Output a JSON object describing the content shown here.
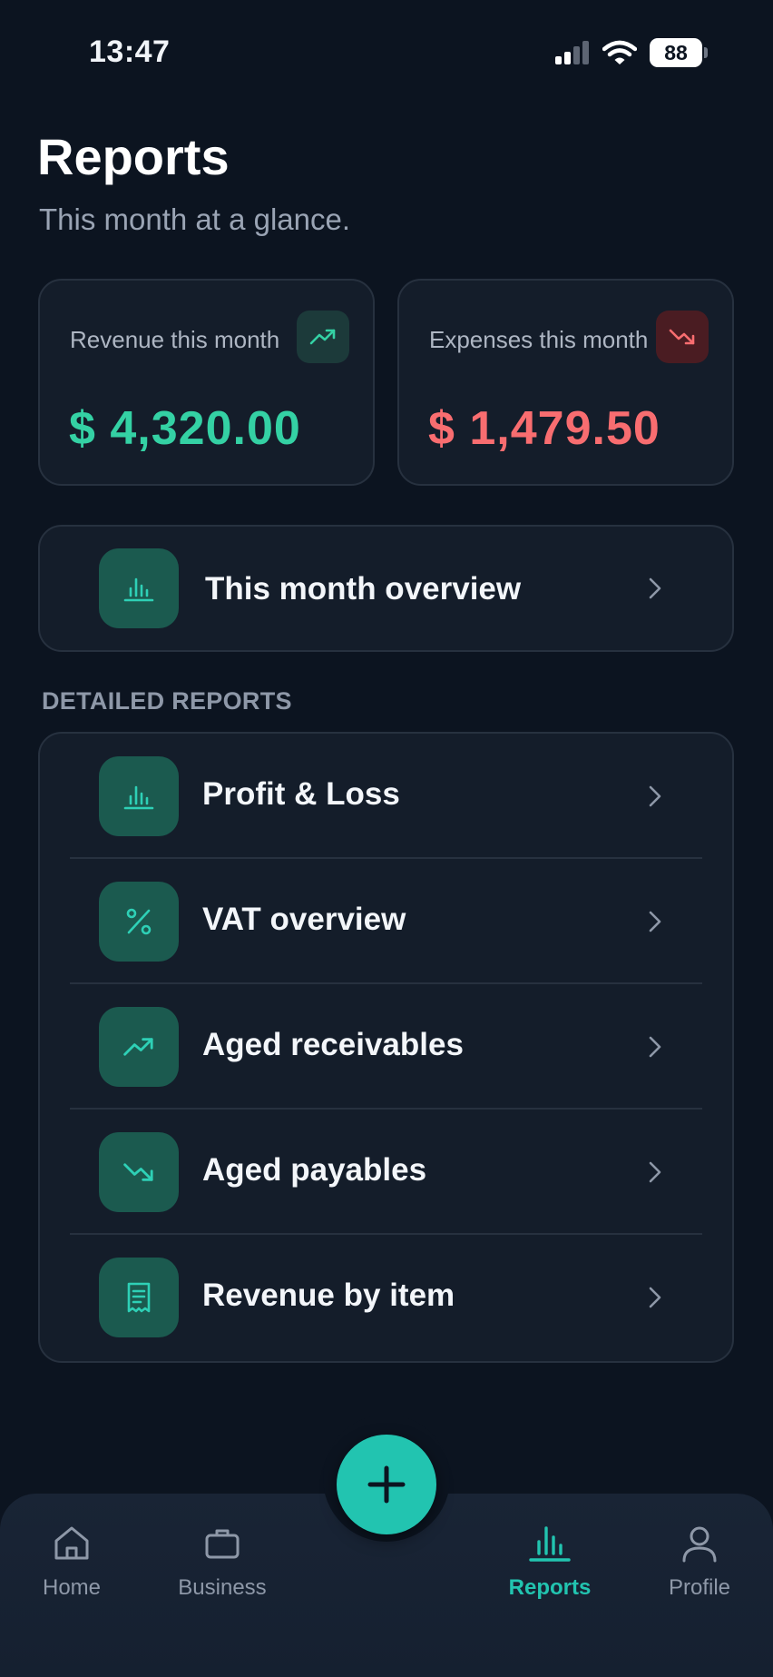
{
  "status_bar": {
    "time": "13:47",
    "battery": "88",
    "icons": [
      "signal-icon",
      "wifi-icon",
      "battery-icon"
    ]
  },
  "header": {
    "title": "Reports",
    "subtitle": "This month at a glance."
  },
  "stats": {
    "revenue": {
      "label": "Revenue this month",
      "value": "$ 4,320.00",
      "icon": "trending-up-icon",
      "color": "#34d1a4"
    },
    "expenses": {
      "label": "Expenses this month",
      "value": "$ 1,479.50",
      "icon": "trending-down-icon",
      "color": "#f86d70"
    }
  },
  "overview": {
    "label": "This month overview",
    "icon": "bar-chart-icon"
  },
  "detailed": {
    "header": "DETAILED REPORTS",
    "items": [
      {
        "label": "Profit & Loss",
        "icon": "bar-chart-icon"
      },
      {
        "label": "VAT overview",
        "icon": "percent-icon"
      },
      {
        "label": "Aged receivables",
        "icon": "trending-up-icon"
      },
      {
        "label": "Aged payables",
        "icon": "trending-down-icon"
      },
      {
        "label": "Revenue by item",
        "icon": "receipt-icon"
      }
    ]
  },
  "tab_bar": {
    "add_icon": "plus-icon",
    "tabs": [
      {
        "label": "Home",
        "icon": "home-icon",
        "active": false
      },
      {
        "label": "Business",
        "icon": "briefcase-icon",
        "active": false
      },
      {
        "label": "Reports",
        "icon": "bar-chart-icon",
        "active": true
      },
      {
        "label": "Profile",
        "icon": "user-icon",
        "active": false
      }
    ]
  },
  "colors": {
    "accent": "#22c4b0",
    "icon_tile": "#1b5a4f",
    "background": "#0c1420",
    "card": "#141d2a"
  }
}
